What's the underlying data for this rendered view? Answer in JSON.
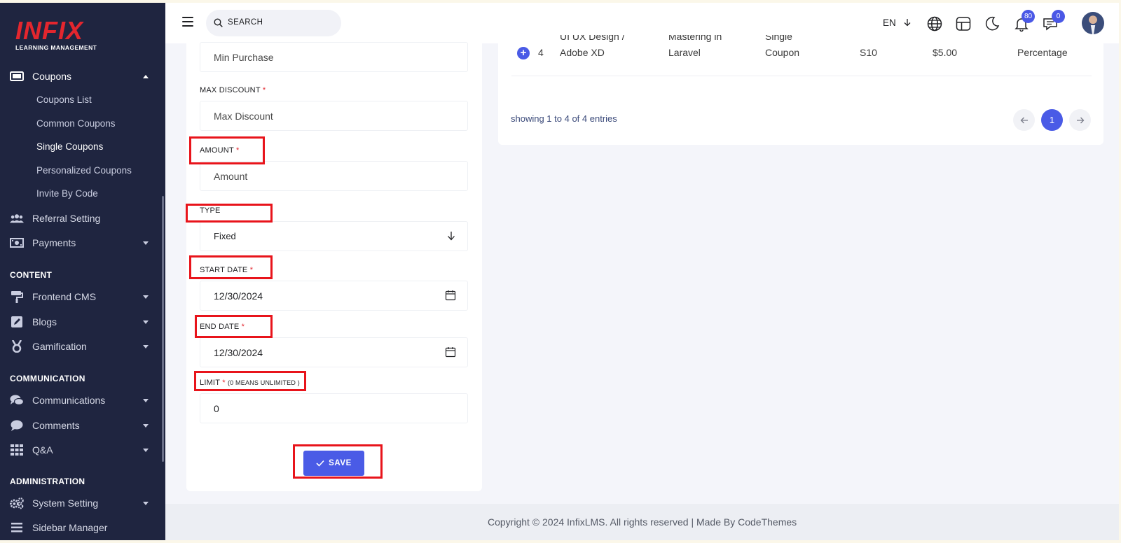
{
  "brand": {
    "logo_text": "INFIX",
    "logo_subtitle": "LEARNING MANAGEMENT",
    "accent_color": "#e3262e",
    "primary_color": "#4a5be6"
  },
  "sidebar": {
    "coupons": {
      "label": "Coupons",
      "icon": "ticket-icon",
      "expanded": true
    },
    "coupon_subitems": [
      {
        "label": "Coupons List"
      },
      {
        "label": "Common Coupons"
      },
      {
        "label": "Single Coupons",
        "active": true
      },
      {
        "label": "Personalized Coupons"
      },
      {
        "label": "Invite By Code"
      }
    ],
    "referral": {
      "label": "Referral Setting",
      "icon": "users-icon"
    },
    "payments": {
      "label": "Payments",
      "icon": "money-icon"
    },
    "section_content": "CONTENT",
    "frontend_cms": {
      "label": "Frontend CMS",
      "icon": "paint-roller-icon"
    },
    "blogs": {
      "label": "Blogs",
      "icon": "edit-icon"
    },
    "gamification": {
      "label": "Gamification",
      "icon": "medal-icon"
    },
    "section_communication": "COMMUNICATION",
    "communications": {
      "label": "Communications",
      "icon": "chat-bubbles-icon"
    },
    "comments": {
      "label": "Comments",
      "icon": "comment-icon"
    },
    "qa": {
      "label": "Q&A",
      "icon": "grid-icon"
    },
    "section_administration": "ADMINISTRATION",
    "system_setting": {
      "label": "System Setting",
      "icon": "gears-icon"
    },
    "sidebar_manager": {
      "label": "Sidebar Manager",
      "icon": "bars-icon"
    }
  },
  "header": {
    "search_placeholder": "SEARCH",
    "language": "EN",
    "notifications_count": "80",
    "messages_count": "0"
  },
  "form": {
    "min_purchase": {
      "placeholder": "Min Purchase"
    },
    "max_discount": {
      "label": "MAX DISCOUNT",
      "required": "*",
      "placeholder": "Max Discount"
    },
    "amount": {
      "label": "AMOUNT",
      "required": "*",
      "placeholder": "Amount"
    },
    "type": {
      "label": "TYPE",
      "value": "Fixed"
    },
    "start_date": {
      "label": "START DATE",
      "required": "*",
      "value": "12/30/2024"
    },
    "end_date": {
      "label": "END DATE",
      "required": "*",
      "value": "12/30/2024"
    },
    "limit": {
      "label": "LIMIT",
      "required": "*",
      "note": "(0 MEANS UNLIMITED )",
      "value": "0"
    },
    "save_label": "SAVE"
  },
  "table": {
    "row": {
      "index": "4",
      "course_line1": "UI UX Design /",
      "course_line2": "Adobe XD",
      "title_line1": "Mastering in",
      "title_line2": "Laravel",
      "type_line1": "Single",
      "type_line2": "Coupon",
      "code": "S10",
      "amount": "$5.00",
      "discount_type": "Percentage"
    },
    "entries_text": "showing 1 to 4 of 4 entries",
    "current_page": "1"
  },
  "footer": {
    "text": "Copyright © 2024 InfixLMS. All rights reserved | Made By CodeThemes"
  }
}
